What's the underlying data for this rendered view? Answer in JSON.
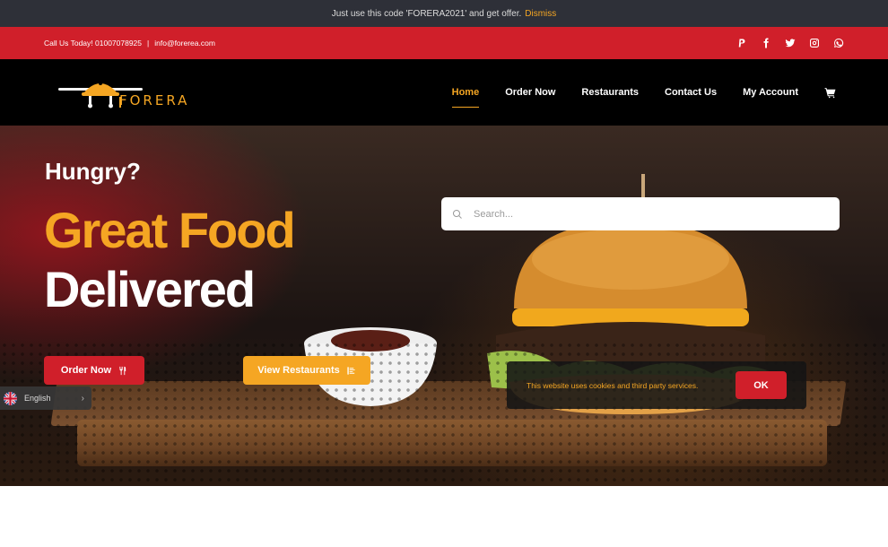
{
  "promo": {
    "text": "Just use this code 'FORERA2021' and get offer.",
    "dismiss": "Dismiss"
  },
  "contact": {
    "phone": "Call Us Today! 01007078925",
    "separator": "|",
    "email": "info@forerea.com"
  },
  "social_icons": [
    "paypal-icon",
    "facebook-icon",
    "twitter-icon",
    "instagram-icon",
    "whatsapp-icon"
  ],
  "logo": {
    "text": "FORERA"
  },
  "nav": {
    "home": "Home",
    "order_now": "Order Now",
    "restaurants": "Restaurants",
    "contact_us": "Contact Us",
    "my_account": "My Account"
  },
  "hero": {
    "hungry": "Hungry?",
    "headline_1": "Great Food",
    "headline_2": "Delivered",
    "order_button": "Order Now",
    "view_button": "View Restaurants"
  },
  "search": {
    "placeholder": "Search...",
    "value": ""
  },
  "language": {
    "current": "English"
  },
  "cookie": {
    "message": "This website uses cookies and third party services.",
    "ok": "OK"
  },
  "colors": {
    "accent": "#f5a623",
    "brand_red": "#d01f2a",
    "dark_bar": "#2e3038",
    "header_bg": "#000000"
  }
}
